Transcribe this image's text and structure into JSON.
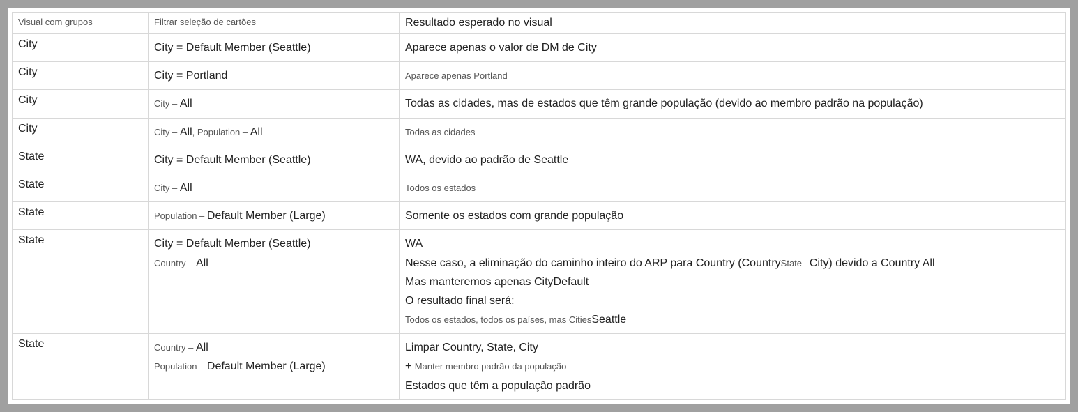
{
  "headers": {
    "col1": "Visual com grupos",
    "col2": "Filtrar seleção de cartões",
    "col3": "Resultado esperado no visual"
  },
  "rows": [
    {
      "visual": "City",
      "visualClass": "big",
      "filter": [
        {
          "text": "City = Default Member (Seattle)",
          "cls": "big"
        }
      ],
      "result": [
        {
          "text": "Aparece apenas o valor de DM de City",
          "cls": "big"
        }
      ]
    },
    {
      "visual": "City",
      "visualClass": "big",
      "filter": [
        {
          "text": "City = Portland",
          "cls": "big"
        }
      ],
      "result": [
        {
          "text": "Aparece apenas Portland",
          "cls": "small"
        }
      ]
    },
    {
      "visual": "City",
      "visualClass": "big",
      "filter": [
        {
          "segments": [
            {
              "text": "City – ",
              "cls": "small"
            },
            {
              "text": "All",
              "cls": "big"
            }
          ]
        }
      ],
      "result": [
        {
          "text": "Todas as cidades, mas de estados que têm grande população (devido ao membro padrão na população)",
          "cls": "big"
        }
      ]
    },
    {
      "visual": "City",
      "visualClass": "big",
      "filter": [
        {
          "segments": [
            {
              "text": "City – ",
              "cls": "small"
            },
            {
              "text": "All",
              "cls": "big"
            },
            {
              "text": ", Population – ",
              "cls": "small"
            },
            {
              "text": " All",
              "cls": "big"
            }
          ]
        }
      ],
      "result": [
        {
          "text": "Todas as cidades",
          "cls": "small"
        }
      ]
    },
    {
      "visual": "State",
      "visualClass": "big",
      "filter": [
        {
          "text": "City = Default Member (Seattle)",
          "cls": "big"
        }
      ],
      "result": [
        {
          "text": "WA, devido ao padrão de Seattle",
          "cls": "big"
        }
      ]
    },
    {
      "visual": "State",
      "visualClass": "big",
      "filter": [
        {
          "segments": [
            {
              "text": "City – ",
              "cls": "small"
            },
            {
              "text": "All",
              "cls": "big"
            }
          ]
        }
      ],
      "result": [
        {
          "text": "Todos os estados",
          "cls": "small"
        }
      ]
    },
    {
      "visual": "State",
      "visualClass": "big",
      "filter": [
        {
          "segments": [
            {
              "text": "Population – ",
              "cls": "small"
            },
            {
              "text": " Default Member (Large)",
              "cls": "big"
            }
          ]
        }
      ],
      "result": [
        {
          "text": "Somente os estados com grande população",
          "cls": "big"
        }
      ]
    },
    {
      "visual": "State",
      "visualClass": "big",
      "filter": [
        {
          "text": "City = Default Member (Seattle)",
          "cls": "big"
        },
        {
          "segments": [
            {
              "text": "Country – ",
              "cls": "small"
            },
            {
              "text": " All",
              "cls": "big"
            }
          ]
        }
      ],
      "result": [
        {
          "text": "WA",
          "cls": "big"
        },
        {
          "segments": [
            {
              "text": "Nesse caso, a eliminação do caminho inteiro do ARP para Country (Country",
              "cls": "big"
            },
            {
              "text": "State –",
              "cls": "small"
            },
            {
              "text": "City) devido a Country ",
              "cls": "big"
            },
            {
              "text": "All",
              "cls": "big"
            }
          ]
        },
        {
          "segments": [
            {
              "text": "Mas manteremos apenas City",
              "cls": "big"
            },
            {
              "text": "Default",
              "cls": "big"
            }
          ]
        },
        {
          "text": "O resultado final será:",
          "cls": "big"
        },
        {
          "segments": [
            {
              "text": "Todos os estados, todos os países, mas Cities",
              "cls": "small"
            },
            {
              "text": "Seattle",
              "cls": "big"
            }
          ]
        }
      ]
    },
    {
      "visual": "State",
      "visualClass": "big",
      "filter": [
        {
          "segments": [
            {
              "text": "Country – ",
              "cls": "small"
            },
            {
              "text": " All",
              "cls": "big"
            }
          ]
        },
        {
          "segments": [
            {
              "text": "Population – ",
              "cls": "small"
            },
            {
              "text": " Default Member (Large)",
              "cls": "big"
            }
          ]
        }
      ],
      "result": [
        {
          "text": "Limpar Country, State, City",
          "cls": "big"
        },
        {
          "segments": [
            {
              "text": "+ ",
              "cls": "big"
            },
            {
              "text": "Manter membro padrão da população",
              "cls": "small"
            }
          ]
        },
        {
          "text": "Estados que têm a população padrão",
          "cls": "big"
        }
      ]
    }
  ]
}
